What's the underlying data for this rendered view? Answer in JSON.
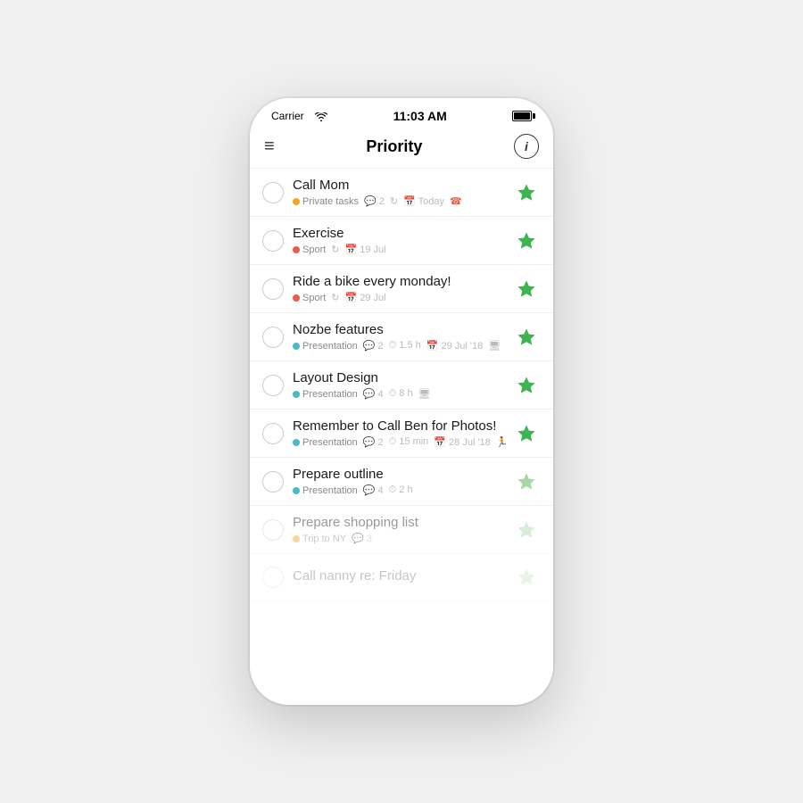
{
  "statusBar": {
    "carrier": "Carrier",
    "wifi": "WiFi",
    "time": "11:03 AM",
    "battery": "Battery"
  },
  "navBar": {
    "menuIcon": "≡",
    "title": "Priority",
    "infoIcon": "i"
  },
  "tasks": [
    {
      "id": 1,
      "title": "Call Mom",
      "tag": "Private tasks",
      "tagColor": "orange",
      "meta": [
        "💬 2",
        "↻",
        "📅 Today",
        "📞"
      ],
      "metaText": [
        "2",
        "Today"
      ],
      "star": "green",
      "faded": false
    },
    {
      "id": 2,
      "title": "Exercise",
      "tag": "Sport",
      "tagColor": "red",
      "meta": [
        "↻",
        "📅 19 Jul"
      ],
      "metaText": [
        "19 Jul"
      ],
      "star": "green",
      "faded": false
    },
    {
      "id": 3,
      "title": "Ride a bike every monday!",
      "tag": "Sport",
      "tagColor": "red",
      "meta": [
        "↻",
        "📅 29 Jul"
      ],
      "metaText": [
        "29 Jul"
      ],
      "star": "green",
      "faded": false
    },
    {
      "id": 4,
      "title": "Nozbe features",
      "tag": "Presentation",
      "tagColor": "blue",
      "meta": [
        "💬 2",
        "⏱ 1.5 h",
        "📅 29 Jul '18",
        "🖥"
      ],
      "metaText": [
        "2",
        "1.5 h",
        "29 Jul '18"
      ],
      "star": "green",
      "faded": false
    },
    {
      "id": 5,
      "title": "Layout Design",
      "tag": "Presentation",
      "tagColor": "blue",
      "meta": [
        "💬 4",
        "⏱ 8 h",
        "🖥"
      ],
      "metaText": [
        "4",
        "8 h"
      ],
      "star": "green",
      "faded": false
    },
    {
      "id": 6,
      "title": "Remember to Call Ben for Photos!",
      "tag": "Presentation",
      "tagColor": "blue",
      "meta": [
        "💬 2",
        "⏱ 15 min",
        "📅 28 Jul '18",
        "🏃"
      ],
      "metaText": [
        "2",
        "15 min",
        "28 Jul '18"
      ],
      "star": "green",
      "faded": false
    },
    {
      "id": 7,
      "title": "Prepare outline",
      "tag": "Presentation",
      "tagColor": "blue",
      "meta": [
        "💬 4",
        "⏱ 2 h"
      ],
      "metaText": [
        "4",
        "2 h"
      ],
      "star": "light-green",
      "faded": false
    },
    {
      "id": 8,
      "title": "Prepare shopping list",
      "tag": "Trip to NY",
      "tagColor": "orange",
      "meta": [
        "💬 3"
      ],
      "metaText": [
        "3"
      ],
      "star": "light-green",
      "faded": true
    },
    {
      "id": 9,
      "title": "Call nanny re: Friday",
      "tag": "",
      "tagColor": "",
      "meta": [],
      "metaText": [],
      "star": "light-green",
      "faded": true,
      "veryFaded": true
    }
  ]
}
